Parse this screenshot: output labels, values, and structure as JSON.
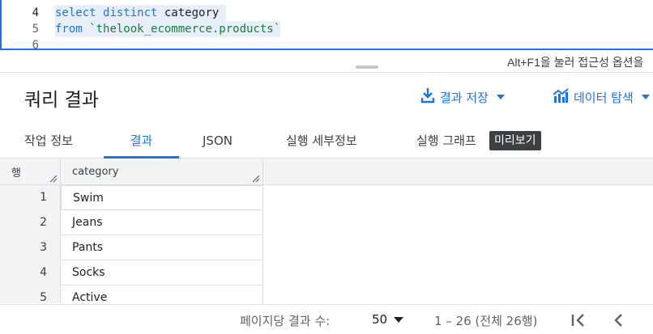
{
  "editor": {
    "lines": [
      {
        "number": "4",
        "tokens": [
          {
            "text": "select",
            "kind": "kw"
          },
          {
            "text": " ",
            "kind": "plain"
          },
          {
            "text": "distinct",
            "kind": "kw"
          },
          {
            "text": " category ",
            "kind": "plain"
          }
        ]
      },
      {
        "number": "5",
        "tokens": [
          {
            "text": "from",
            "kind": "kw"
          },
          {
            "text": " ",
            "kind": "plain"
          },
          {
            "text": "`thelook_ecommerce.products`",
            "kind": "str"
          }
        ]
      },
      {
        "number": "6",
        "tokens": []
      }
    ],
    "a11y_hint": "Alt+F1을 눌러 접근성 옵션을"
  },
  "results": {
    "title": "쿼리 결과",
    "save_label": "결과 저장",
    "explore_label": "데이터 탐색"
  },
  "tabs": {
    "job_info": "작업 정보",
    "results": "결과",
    "json": "JSON",
    "execution_details": "실행 세부정보",
    "execution_graph": "실행 그래프",
    "preview_badge": "미리보기"
  },
  "grid": {
    "row_header": "행",
    "column_header": "category",
    "rows": [
      {
        "num": "1",
        "value": "Swim"
      },
      {
        "num": "2",
        "value": "Jeans"
      },
      {
        "num": "3",
        "value": "Pants"
      },
      {
        "num": "4",
        "value": "Socks"
      },
      {
        "num": "5",
        "value": "Active"
      }
    ]
  },
  "footer": {
    "per_page_label": "페이지당 결과 수:",
    "page_size": "50",
    "range": "1 – 26 (전체 26행)"
  },
  "colors": {
    "accent": "#1a73e8",
    "keyword": "#1a73e8",
    "string": "#188038"
  }
}
